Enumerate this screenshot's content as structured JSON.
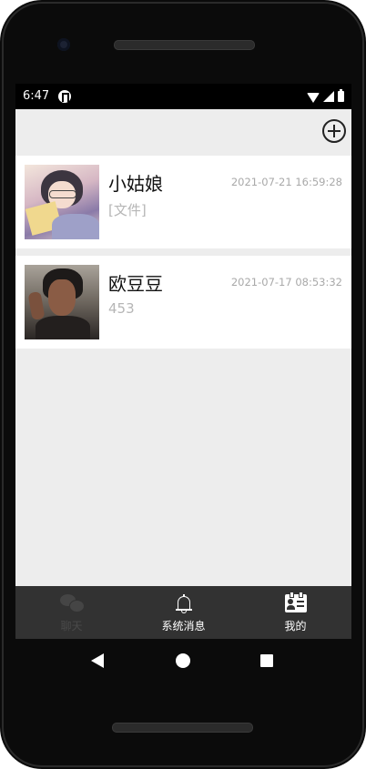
{
  "status_bar": {
    "time": "6:47"
  },
  "app_bar": {
    "add_icon": "add-circle-icon"
  },
  "chats": [
    {
      "name": "小姑娘",
      "time": "2021-07-21 16:59:28",
      "preview": "[文件]"
    },
    {
      "name": "欧豆豆",
      "time": "2021-07-17 08:53:32",
      "preview": "453"
    }
  ],
  "tab_bar": {
    "tabs": [
      {
        "label": "聊天",
        "icon": "chat-bubbles-icon",
        "color": "#4a4a4a"
      },
      {
        "label": "系统消息",
        "icon": "bell-icon",
        "color": "#ffffff"
      },
      {
        "label": "我的",
        "icon": "contact-card-icon",
        "color": "#ffffff"
      }
    ]
  },
  "colors": {
    "screen_background": "#ededed",
    "tab_bar_background": "#323232",
    "timestamp_gray": "#a9a9a9"
  }
}
